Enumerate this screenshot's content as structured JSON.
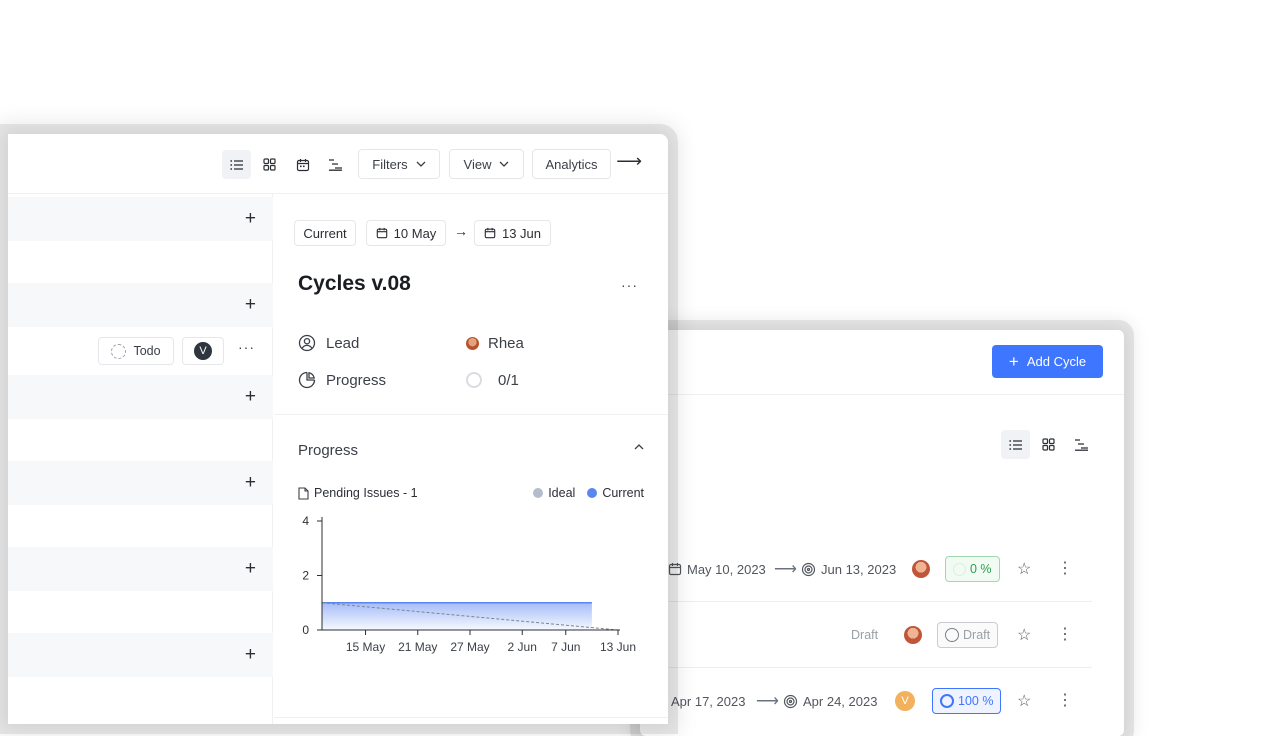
{
  "front_window": {
    "toolbar": {
      "layouts": [
        "list-layout",
        "board-layout",
        "calendar-layout",
        "gantt-layout"
      ],
      "filters_label": "Filters",
      "view_label": "View",
      "analytics_label": "Analytics"
    },
    "issue": {
      "state_label": "Todo",
      "assignee_initial": "V"
    },
    "detail": {
      "status_chip": "Current",
      "start_date": "10 May",
      "end_date": "13 Jun",
      "date_arrow": "→",
      "title": "Cycles v.08",
      "lead_label": "Lead",
      "lead_value": "Rhea",
      "progress_label": "Progress",
      "progress_value": "0/1",
      "section_title": "Progress",
      "pending_label": "Pending Issues - 1",
      "legend_ideal": "Ideal",
      "legend_current": "Current"
    }
  },
  "back_window": {
    "add_cycle_label": "Add Cycle",
    "cycles": [
      {
        "start": "May 10, 2023",
        "end": "Jun 13, 2023",
        "progress": "0 %",
        "status_color": "#2e9e50"
      },
      {
        "draft_label": "Draft",
        "progress": "Draft",
        "status_color": "#9aa0a6"
      },
      {
        "start": "Apr 17, 2023",
        "end": "Apr 24, 2023",
        "avatar_initial": "V",
        "progress": "100 %",
        "status_color": "#3f76ff"
      }
    ]
  },
  "colors": {
    "accent": "#3f76ff",
    "ideal": "#b4bccd",
    "current": "#5b86f0"
  },
  "chart_data": {
    "type": "area",
    "title": "",
    "xlabel": "",
    "ylabel": "",
    "x_ticks": [
      "15 May",
      "21 May",
      "27 May",
      "2 Jun",
      "7 Jun",
      "13 Jun"
    ],
    "y_ticks": [
      0,
      2,
      4
    ],
    "ylim": [
      0,
      4
    ],
    "x_range": [
      "10 May",
      "13 Jun"
    ],
    "legend": "top-right",
    "series": [
      {
        "name": "Ideal",
        "style": "dashed",
        "points": [
          [
            "10 May",
            1
          ],
          [
            "13 Jun",
            0
          ]
        ]
      },
      {
        "name": "Current",
        "style": "area",
        "points": [
          [
            "10 May",
            1
          ],
          [
            "10 Jun",
            1
          ]
        ]
      }
    ]
  }
}
